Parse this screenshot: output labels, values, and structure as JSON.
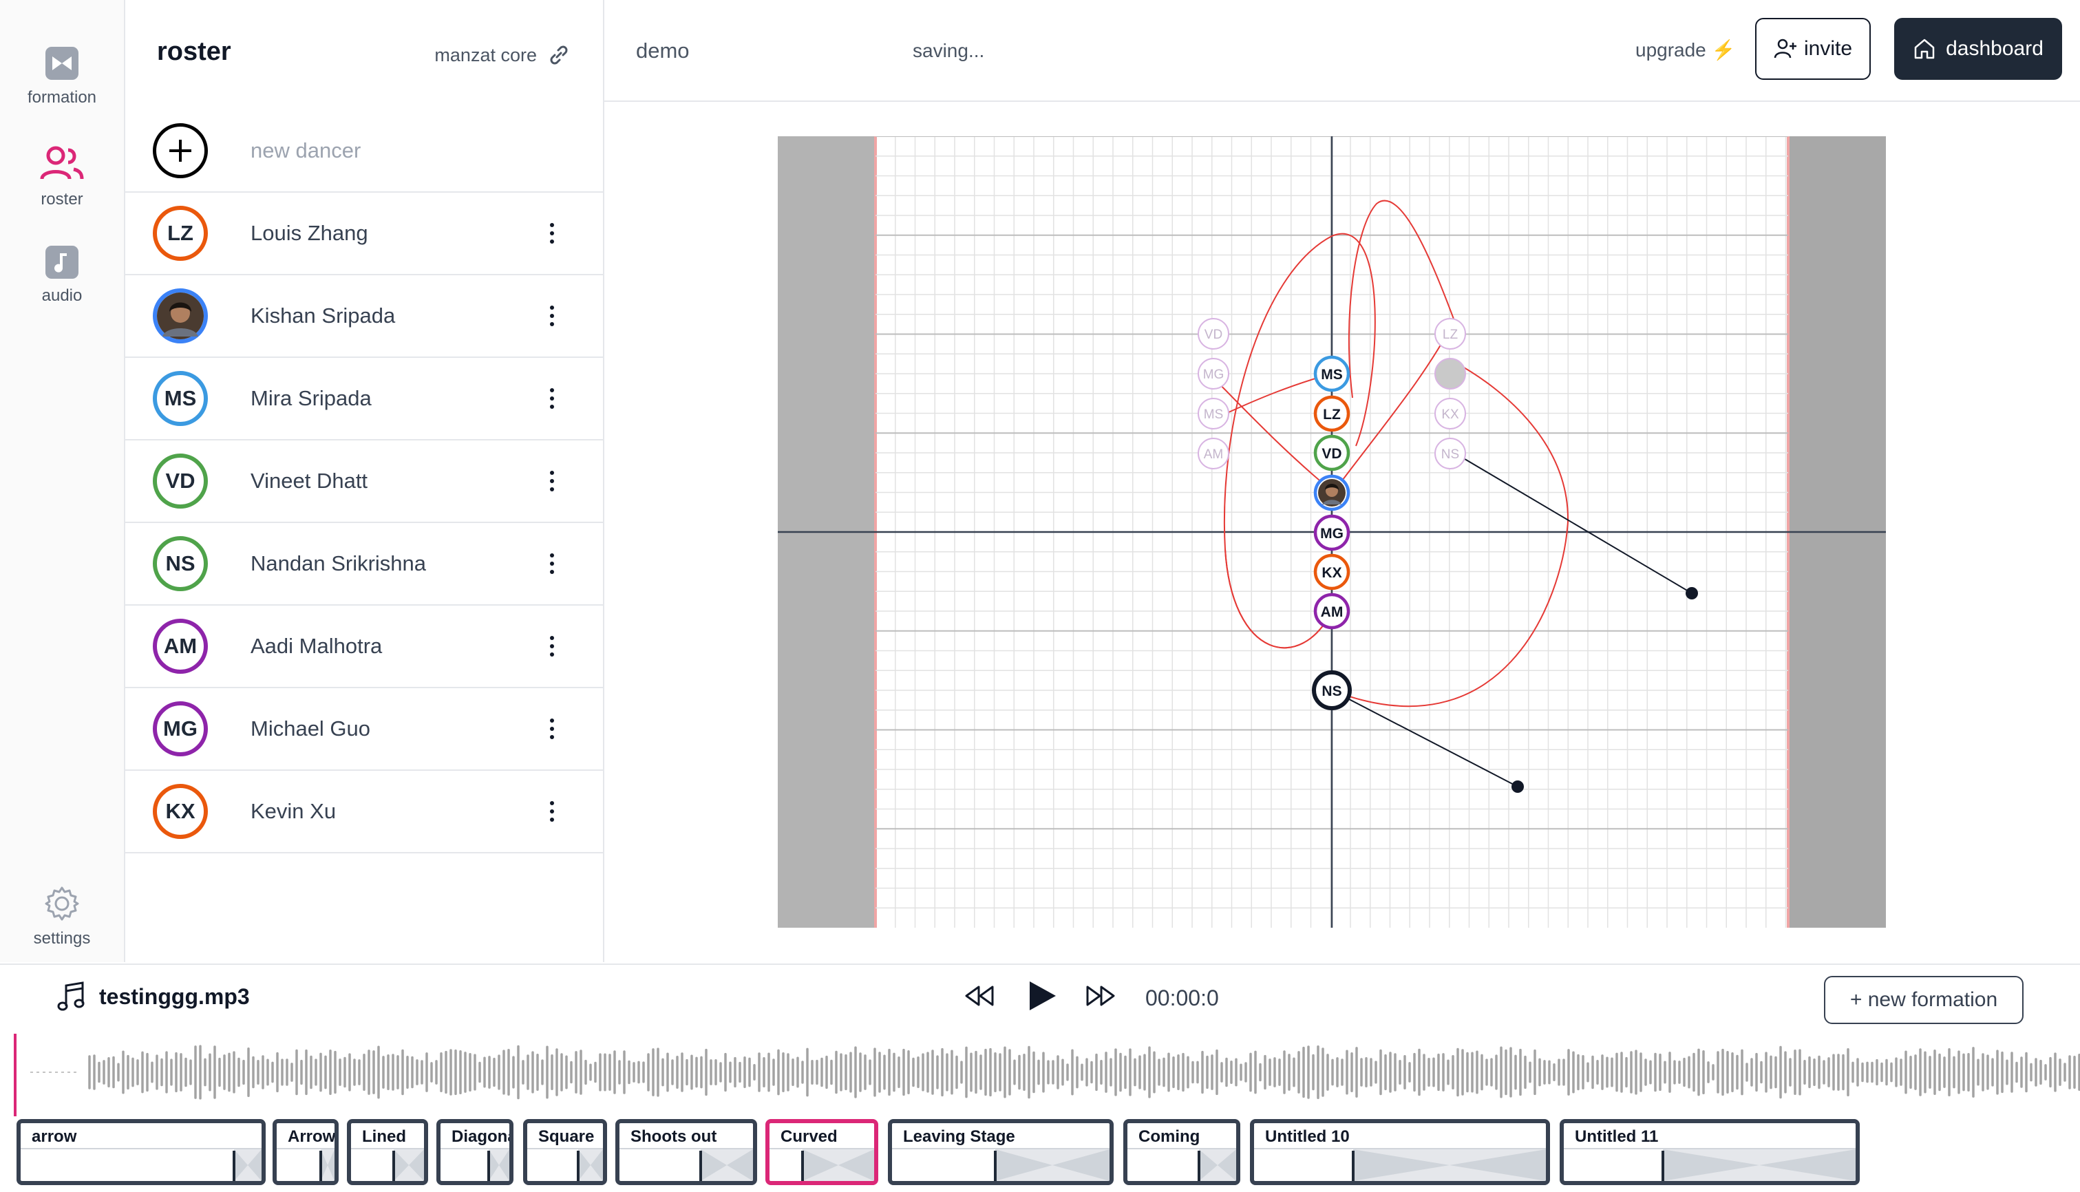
{
  "nav": {
    "items": [
      {
        "label": "formation",
        "icon": "formation-icon"
      },
      {
        "label": "roster",
        "icon": "users-icon"
      },
      {
        "label": "audio",
        "icon": "music-icon"
      }
    ],
    "settings": {
      "label": "settings",
      "icon": "gear-icon"
    }
  },
  "roster": {
    "title": "roster",
    "subtitle": "manzat core",
    "new_dancer": "new dancer",
    "dancers": [
      {
        "initials": "LZ",
        "name": "Louis Zhang",
        "color": "#ea580c"
      },
      {
        "initials": "",
        "name": "Kishan Sripada",
        "color": "#3b82f6",
        "photo": true
      },
      {
        "initials": "MS",
        "name": "Mira Sripada",
        "color": "#3b9ae1"
      },
      {
        "initials": "VD",
        "name": "Vineet Dhatt",
        "color": "#4fa34a"
      },
      {
        "initials": "NS",
        "name": "Nandan Srikrishna",
        "color": "#4fa34a"
      },
      {
        "initials": "AM",
        "name": "Aadi Malhotra",
        "color": "#8e24aa"
      },
      {
        "initials": "MG",
        "name": "Michael Guo",
        "color": "#8e24aa"
      },
      {
        "initials": "KX",
        "name": "Kevin Xu",
        "color": "#ea580c"
      }
    ]
  },
  "header": {
    "project": "demo",
    "status": "saving...",
    "upgrade": "upgrade",
    "invite": "invite",
    "dashboard": "dashboard"
  },
  "stage": {
    "dancers_current": [
      {
        "label": "MS",
        "color": "#3b9ae1"
      },
      {
        "label": "LZ",
        "color": "#ea580c"
      },
      {
        "label": "VD",
        "color": "#4fa34a"
      },
      {
        "label": "",
        "color": "#3b82f6",
        "photo": true
      },
      {
        "label": "MG",
        "color": "#8e24aa"
      },
      {
        "label": "KX",
        "color": "#ea580c"
      },
      {
        "label": "AM",
        "color": "#8e24aa"
      },
      {
        "label": "NS",
        "color": "#111827",
        "selected": true
      }
    ],
    "ghosts_left": [
      "VD",
      "MG",
      "MS",
      "AM"
    ],
    "ghosts_right": [
      "LZ",
      "",
      "KX",
      "NS"
    ]
  },
  "player": {
    "track": "testinggg.mp3",
    "time": "00:00:0",
    "new_formation": "+ new formation"
  },
  "formations": [
    {
      "label": "arrow",
      "active": false
    },
    {
      "label": "Arrow",
      "active": false
    },
    {
      "label": "Lined",
      "active": false
    },
    {
      "label": "Diagonal",
      "active": false
    },
    {
      "label": "Square",
      "active": false
    },
    {
      "label": "Shoots out",
      "active": false
    },
    {
      "label": "Curved",
      "active": true
    },
    {
      "label": "Leaving Stage",
      "active": false
    },
    {
      "label": "Coming",
      "active": false
    },
    {
      "label": "Untitled 10",
      "active": false
    },
    {
      "label": "Untitled 11",
      "active": false
    }
  ],
  "colors": {
    "accent": "#db2777",
    "dark": "#1f2937",
    "path": "#e53935"
  }
}
